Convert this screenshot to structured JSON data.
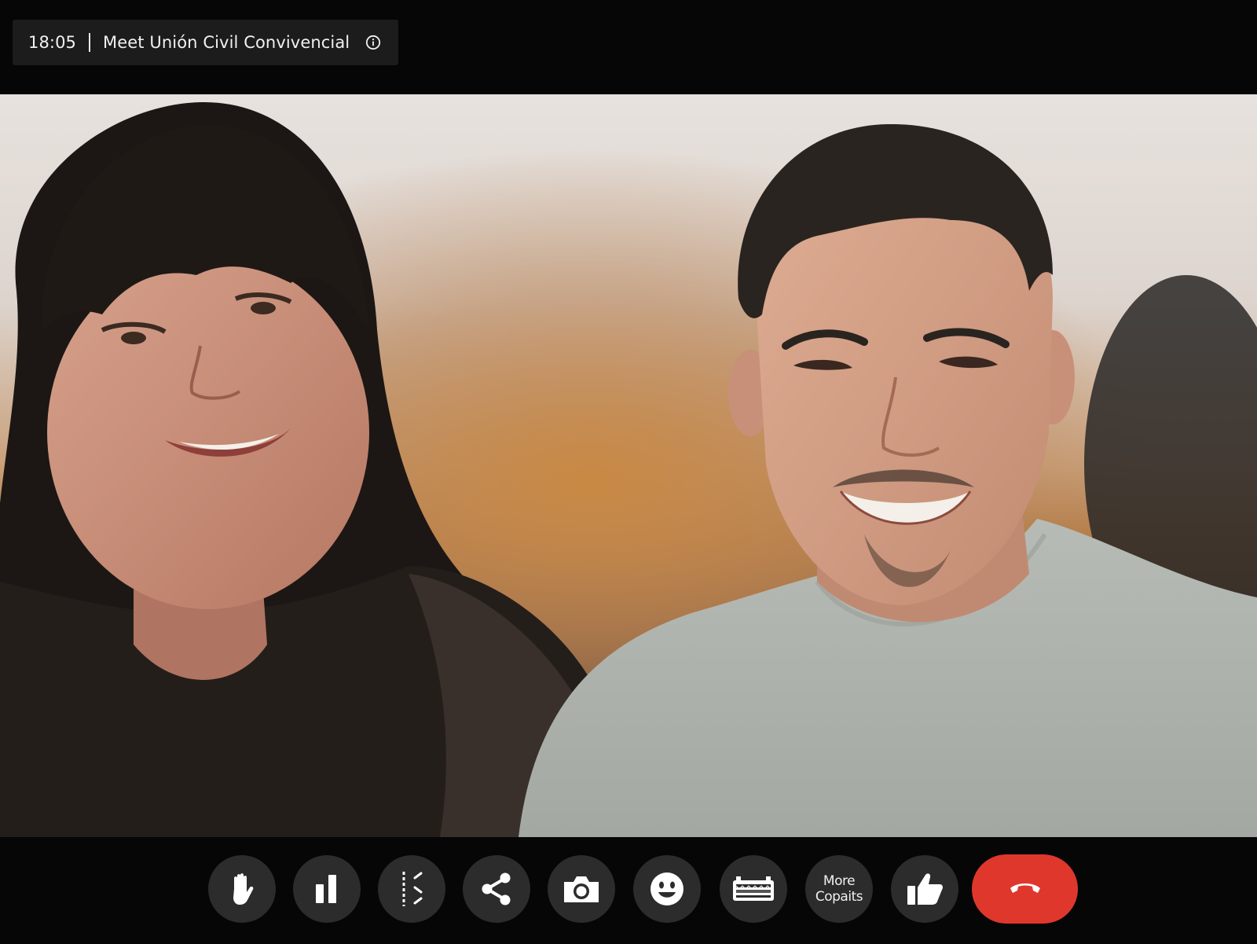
{
  "header": {
    "time": "18:05",
    "meeting_title": "Meet Unión Civil Convivencial",
    "info_icon": "info-icon"
  },
  "participants": [
    {
      "tile": "participant-left",
      "avatar": "woman-with-dark-hair-and-bangs"
    },
    {
      "tile": "participant-right",
      "avatar": "man-with-short-dark-hair-grey-tshirt"
    }
  ],
  "controls": {
    "raise_hand_icon": "hand-icon",
    "pause_icon": "pause-icon",
    "layout_icon": "dotted-layout-icon",
    "share_icon": "share-icon",
    "camera_icon": "camera-icon",
    "reactions_icon": "smiley-icon",
    "keyboard_icon": "keyboard-icon",
    "more_line1": "More",
    "more_line2": "Copaits",
    "like_icon": "thumbs-up-icon",
    "end_call_icon": "phone-hangup-icon"
  },
  "colors": {
    "background": "#060606",
    "chip": "#1c1c1c",
    "control_button": "#2c2c2c",
    "end_call": "#e0372c"
  }
}
